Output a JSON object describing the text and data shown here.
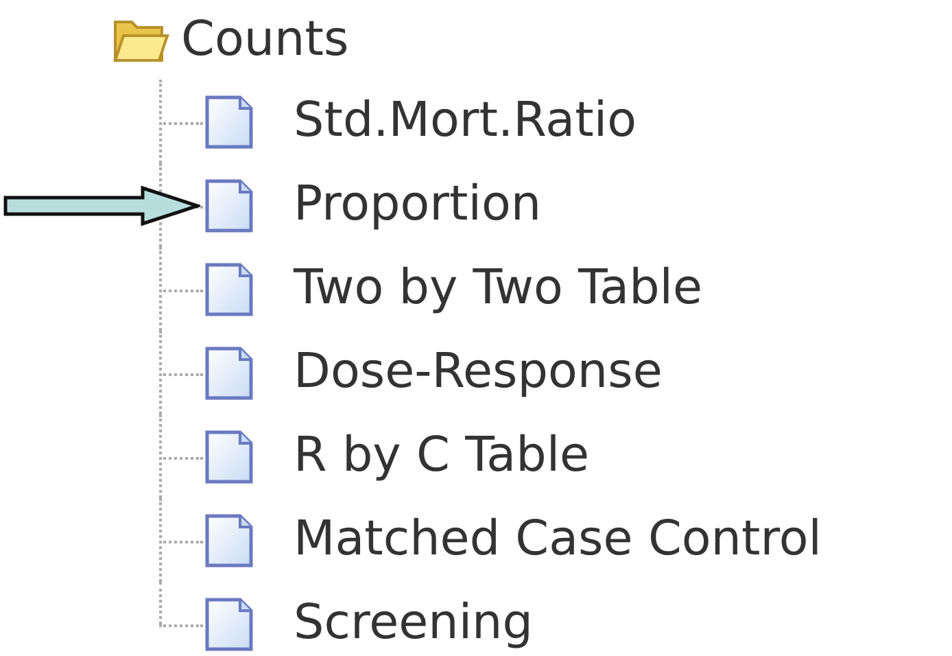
{
  "tree": {
    "label": "Counts",
    "expanded": true,
    "children": [
      {
        "label": "Std.Mort.Ratio",
        "pointed": false
      },
      {
        "label": "Proportion",
        "pointed": true
      },
      {
        "label": "Two by Two Table",
        "pointed": false
      },
      {
        "label": "Dose-Response",
        "pointed": false
      },
      {
        "label": "R by C Table",
        "pointed": false
      },
      {
        "label": "Matched Case Control",
        "pointed": false
      },
      {
        "label": "Screening",
        "pointed": false
      }
    ]
  }
}
